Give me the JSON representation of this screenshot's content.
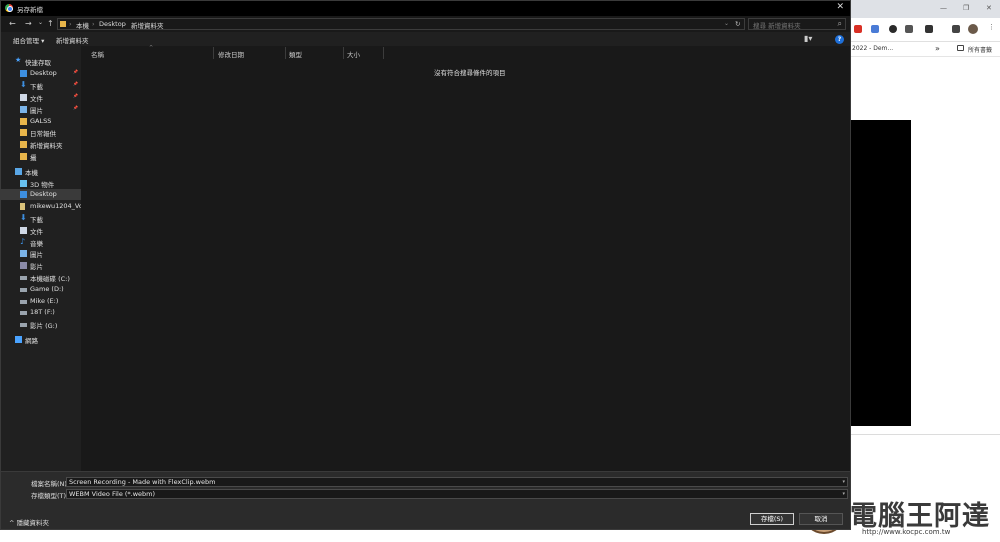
{
  "dialog": {
    "title": "另存新檔",
    "close_glyph": "✕",
    "nav": {
      "back": "←",
      "forward": "→",
      "recent": "⌄",
      "up": "↑"
    },
    "breadcrumb": [
      "本機",
      "Desktop",
      "新增資料夾"
    ],
    "breadcrumb_sep": "›",
    "address_dropdown": "⌄",
    "refresh_glyph": "↻",
    "search_placeholder": "搜尋 新增資料夾",
    "search_glyph": "⌕",
    "toolbar": {
      "organize": "組合管理 ▾",
      "new_folder": "新增資料夾",
      "view_glyph": "▮▾",
      "help": "?"
    },
    "sidebar": {
      "quick_access": "快速存取",
      "quick_items": [
        {
          "label": "Desktop",
          "pinned": true
        },
        {
          "label": "下載",
          "pinned": true
        },
        {
          "label": "文件",
          "pinned": true
        },
        {
          "label": "圖片",
          "pinned": true
        },
        {
          "label": "GALSS",
          "pinned": false
        },
        {
          "label": "日常報供",
          "pinned": false
        },
        {
          "label": "新增資料夾",
          "pinned": false
        },
        {
          "label": "攝",
          "pinned": false
        }
      ],
      "this_pc": "本機",
      "pc_items": [
        "3D 物件",
        "Desktop",
        "mikewu1204_Vol.1",
        "下載",
        "文件",
        "音樂",
        "圖片",
        "影片",
        "本機磁碟 (C:)",
        "Game (D:)",
        "Mike (E:)",
        "18T (F:)",
        "影片 (G:)"
      ],
      "network": "網路",
      "pin_glyph": "📌"
    },
    "columns": [
      "名稱",
      "修改日期",
      "類型",
      "大小"
    ],
    "sort_glyph": "^",
    "empty_message": "沒有符合搜尋條件的項目",
    "filename_label": "檔案名稱(N):",
    "filename_value": "Screen Recording - Made with FlexClip.webm",
    "filetype_label": "存檔類型(T):",
    "filetype_value": "WEBM Video File (*.webm)",
    "dropdown_glyph": "▾",
    "hide_folders": "^ 隱藏資料夾",
    "save_button": "存檔(S)",
    "cancel_button": "取消"
  },
  "browser": {
    "window_controls": [
      "—",
      "❐",
      "✕"
    ],
    "tab_title": "2022 - Dem...",
    "overflow": "»",
    "all_bookmarks": "所有書籤"
  },
  "watermark": {
    "text": "電腦王阿達",
    "url": "http://www.kocpc.com.tw"
  },
  "colors": {
    "dialog_bg": "#202020",
    "pane_bg": "#191919",
    "selected": "#3a3a3a",
    "folder": "#e8b54a",
    "accent": "#1e6fd9"
  }
}
